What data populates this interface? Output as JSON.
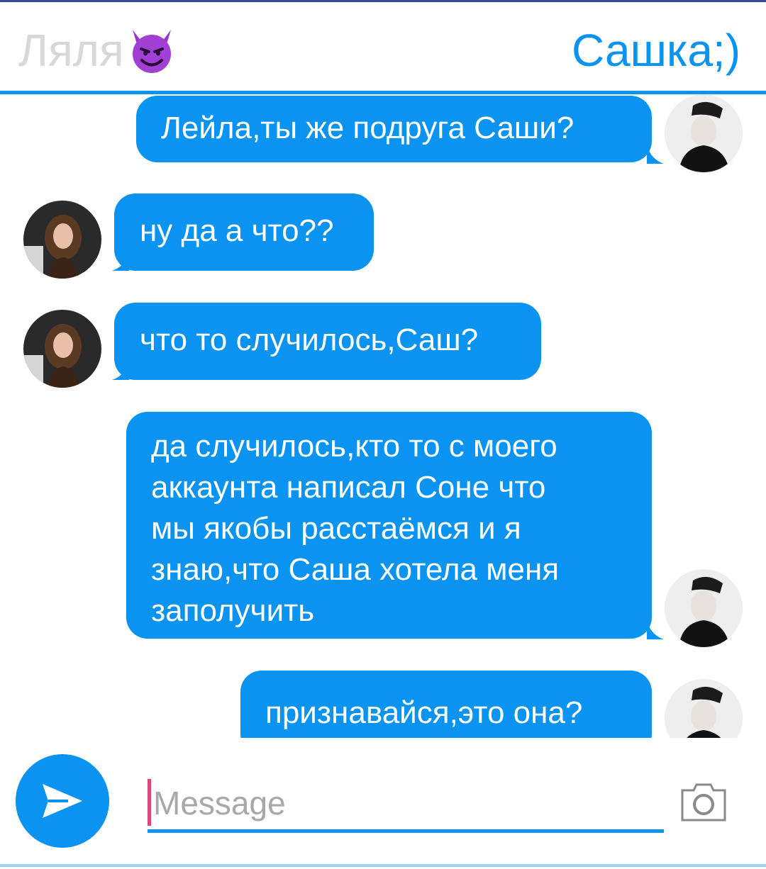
{
  "header": {
    "left_name": "Ляля",
    "right_name": "Сашка;)"
  },
  "messages": [
    {
      "side": "right",
      "text": "Лейла,ты же подруга Саши?"
    },
    {
      "side": "left",
      "text": "ну да а что??"
    },
    {
      "side": "left",
      "text": "что то случилось,Саш?"
    },
    {
      "side": "right",
      "lines": [
        "да случилось,кто то с моего",
        "аккаунта написал Соне что",
        "мы якобы расстаёмся и я",
        "знаю,что Саша хотела меня",
        "заполучить"
      ]
    },
    {
      "side": "right",
      "text": "признавайся,это она?"
    }
  ],
  "composer": {
    "placeholder": "Message",
    "send_icon": "send-icon",
    "camera_icon": "camera-icon"
  },
  "colors": {
    "accent": "#0a93f0",
    "muted": "#d8d8d8",
    "cursor": "#e0457b"
  }
}
